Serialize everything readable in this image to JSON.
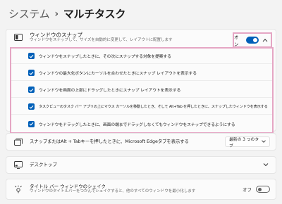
{
  "breadcrumb": {
    "parent": "システム",
    "separator": "›",
    "current": "マルチタスク"
  },
  "snap": {
    "title": "ウィンドウのスナップ",
    "subtitle": "ウィンドウをスナップして、サイズを自動的に変更して、レイアウトに配置します",
    "state_label": "オン",
    "enabled": true,
    "expanded": true,
    "options": [
      {
        "label": "ウィンドウをスナップしたときに、その次にスナップする対象を提案する",
        "checked": true
      },
      {
        "label": "ウィンドウの最大化ボタンにカーソルを合わせたときにスナップ レイアウトを表示する",
        "checked": true
      },
      {
        "label": "ウィンドウを画面の上部にドラッグしたときにスナップ レイアウトを表示する",
        "checked": true
      },
      {
        "label": "タスクビューのタスク バー アプリの上にマウス カーソルを移動したとき、そして Alt+Tab を押したときに、スナップしたウィンドウを表示する",
        "checked": true
      },
      {
        "label": "ウィンドウをドラッグしたときに、画面の端までドラッグしなくてもウィンドウをスナップできるようにする",
        "checked": true
      }
    ]
  },
  "alt_tab": {
    "title": "スナップまたはAlt + Tabキーを押したときに、Microsoft Edgeタブを表示する",
    "dropdown_value": "最新の 3 つのタブ"
  },
  "desktop": {
    "title": "デスクトップ"
  },
  "shake": {
    "title": "タイトル バー ウィンドウのシェイク",
    "subtitle": "ウィンドウのタイトルバーをつかんでシェイクすると、他のすべてのウィンドウを最小化します",
    "state_label": "オフ",
    "enabled": false
  },
  "colors": {
    "accent": "#005fb8",
    "highlight_border": "#e5a6c4",
    "background": "#f3f3f3",
    "card": "#fbfbfb"
  },
  "icons": {
    "snap": "snap-layout-icon",
    "tabs": "tabs-icon",
    "desktop": "desktop-icon",
    "shake": "shake-icon"
  }
}
